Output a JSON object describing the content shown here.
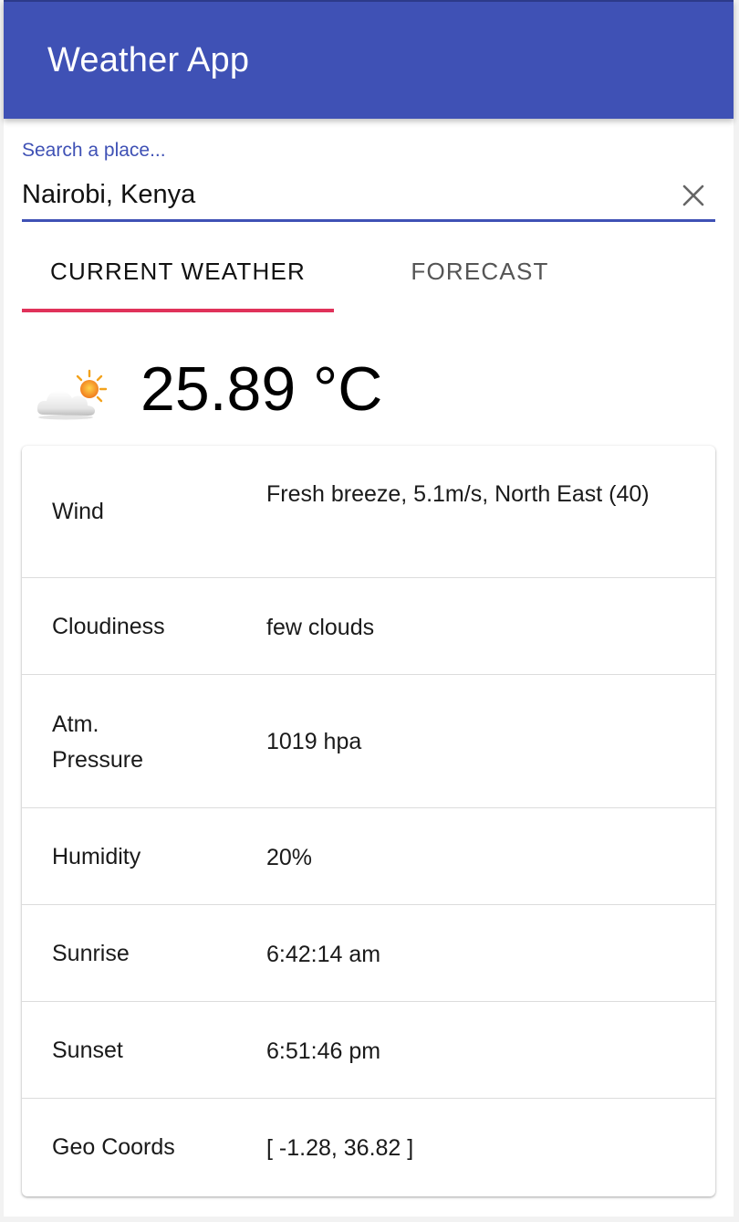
{
  "app": {
    "title": "Weather App"
  },
  "search": {
    "label": "Search a place...",
    "value": "Nairobi, Kenya"
  },
  "tabs": [
    {
      "label": "CURRENT WEATHER",
      "active": true
    },
    {
      "label": "FORECAST",
      "active": false
    }
  ],
  "current": {
    "icon": "partly-cloudy-day-icon",
    "temperature": "25.89 °C"
  },
  "details": [
    {
      "label": "Wind",
      "value": "Fresh breeze, 5.1m/s, North East (40)"
    },
    {
      "label": "Cloudiness",
      "value": "few clouds"
    },
    {
      "label": "Atm. Pressure",
      "value": "1019 hpa"
    },
    {
      "label": "Humidity",
      "value": "20%"
    },
    {
      "label": "Sunrise",
      "value": "6:42:14 am"
    },
    {
      "label": "Sunset",
      "value": "6:51:46 pm"
    },
    {
      "label": "Geo Coords",
      "value": "[ -1.28, 36.82 ]"
    }
  ],
  "colors": {
    "primary": "#3f51b5",
    "tab_indicator": "#e0325a"
  }
}
